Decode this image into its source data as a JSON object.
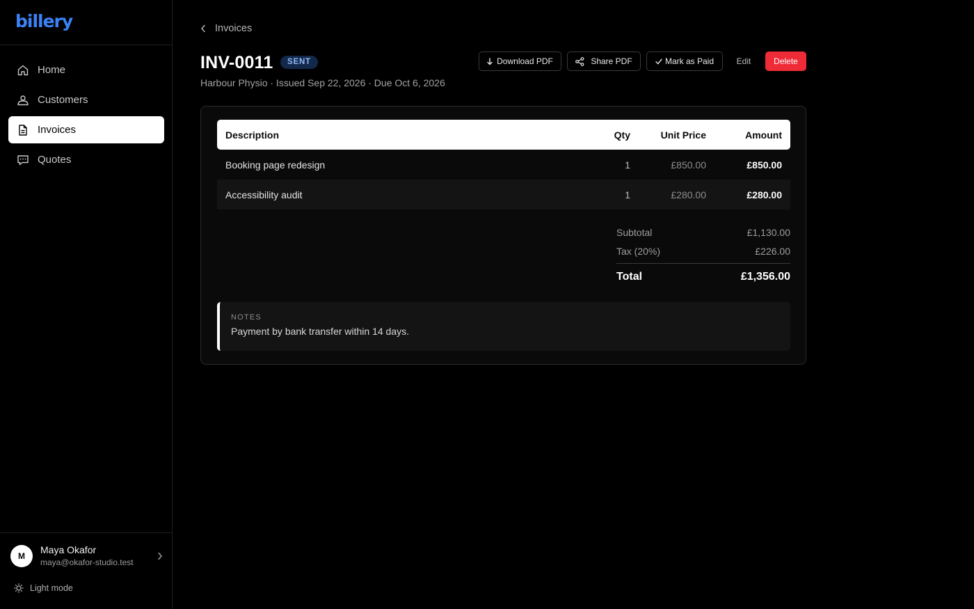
{
  "brand": {
    "name": "billery",
    "accent": "#3b82f6"
  },
  "sidebar": {
    "items": [
      {
        "label": "Home",
        "icon": "home-icon"
      },
      {
        "label": "Customers",
        "icon": "users-icon"
      },
      {
        "label": "Invoices",
        "icon": "document-icon",
        "active": true
      },
      {
        "label": "Quotes",
        "icon": "chat-icon"
      }
    ],
    "user": {
      "initial": "M",
      "name": "Maya Okafor",
      "email": "maya@okafor-studio.test"
    },
    "theme_toggle": "Light mode"
  },
  "header": {
    "back_label": "Invoices",
    "invoice_number": "INV-0011",
    "status": "SENT",
    "subtitle": "Harbour Physio · Issued Sep 22, 2026 · Due Oct 6, 2026"
  },
  "actions": {
    "download": "Download PDF",
    "share": "Share PDF",
    "mark_paid": "Mark as Paid",
    "edit": "Edit",
    "delete": "Delete",
    "delete_color": "#ef2b37"
  },
  "table": {
    "columns": {
      "description": "Description",
      "qty": "Qty",
      "unit_price": "Unit Price",
      "amount": "Amount"
    },
    "rows": [
      {
        "description": "Booking page redesign",
        "qty": "1",
        "unit_price": "£850.00",
        "amount": "£850.00"
      },
      {
        "description": "Accessibility audit",
        "qty": "1",
        "unit_price": "£280.00",
        "amount": "£280.00"
      }
    ]
  },
  "totals": {
    "subtotal_label": "Subtotal",
    "subtotal": "£1,130.00",
    "tax_label": "Tax (20%)",
    "tax": "£226.00",
    "total_label": "Total",
    "total": "£1,356.00"
  },
  "notes": {
    "label": "NOTES",
    "text": "Payment by bank transfer within 14 days."
  }
}
